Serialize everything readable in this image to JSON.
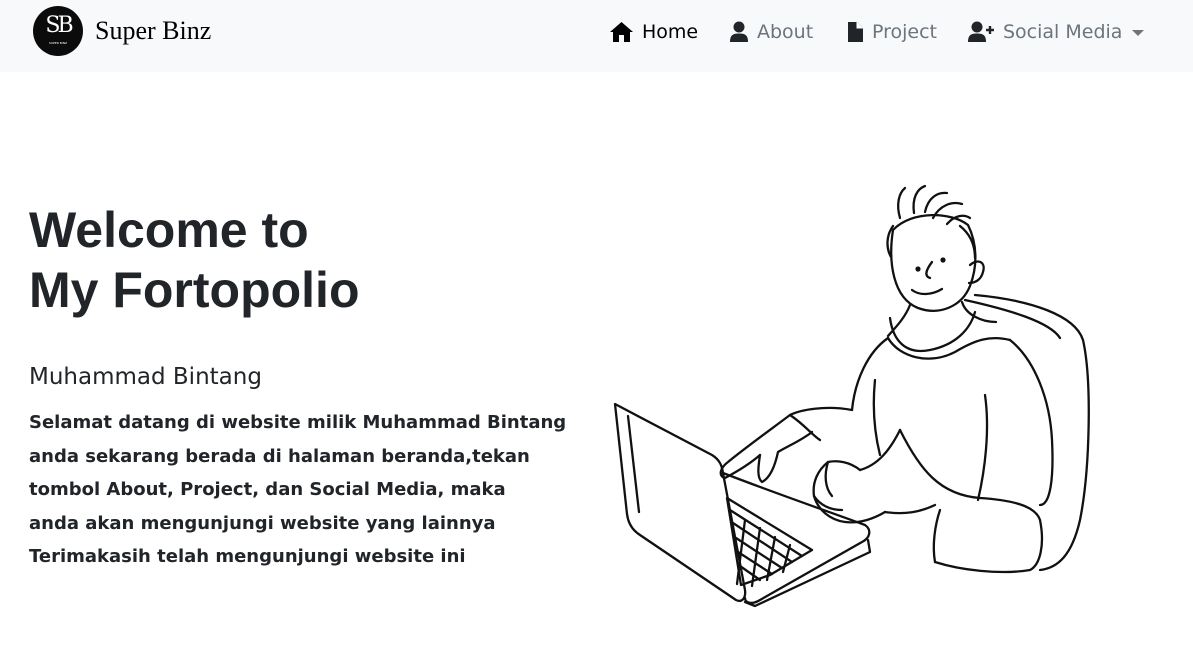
{
  "navbar": {
    "brand": {
      "logo_text": "SB",
      "logo_subtext": "SUPER BINZ",
      "name": "Super Binz"
    },
    "links": [
      {
        "label": "Home",
        "icon": "home-icon",
        "active": true
      },
      {
        "label": "About",
        "icon": "user-icon",
        "active": false
      },
      {
        "label": "Project",
        "icon": "file-icon",
        "active": false
      },
      {
        "label": "Social Media",
        "icon": "user-plus-icon",
        "active": false,
        "dropdown": true
      }
    ]
  },
  "hero": {
    "title_lines": [
      "Welcome to",
      "My Fortopolio"
    ],
    "name": "Muhammad Bintang",
    "description_lines": [
      "Selamat datang di website milik Muhammad Bintang",
      "anda sekarang berada di halaman beranda,tekan",
      "tombol About, Project, dan Social Media, maka",
      "anda akan mengunjungi website yang lainnya",
      "Terimakasih telah mengunjungi website ini"
    ],
    "illustration": "person-with-laptop-illustration"
  },
  "colors": {
    "navbar_bg": "#f8f9fa",
    "text": "#212529",
    "nav_muted": "#6c757d",
    "nav_active": "#000000"
  }
}
